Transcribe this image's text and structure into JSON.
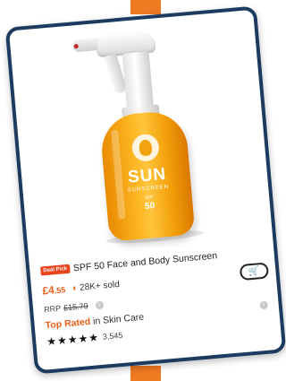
{
  "product": {
    "badge": "Deal Pick",
    "title": "SPF 50 Face and Body Sunscreen",
    "price": {
      "currency": "£",
      "whole": "4",
      "decimal": ".55"
    },
    "sold": "28K+ sold",
    "rrp_label": "RRP",
    "rrp_value": "£15.79",
    "top_rated": "Top Rated",
    "rated_category": "in Skin Care",
    "rating_stars": 5,
    "stars_display": "★★★★★",
    "review_count": "3,545",
    "bottle_label": {
      "brand": "SUN",
      "sub": "SUNSCREEN",
      "spf": "SPF",
      "spf_value": "50"
    }
  },
  "icons": {
    "sold_icon": "flame-icon",
    "cart_icon": "cart-icon",
    "info_icon": "info-icon"
  },
  "colors": {
    "card_border": "#1d3a5f",
    "accent_orange": "#e8601c",
    "badge_red": "#e8451c",
    "background_strip": "#f07a22"
  }
}
